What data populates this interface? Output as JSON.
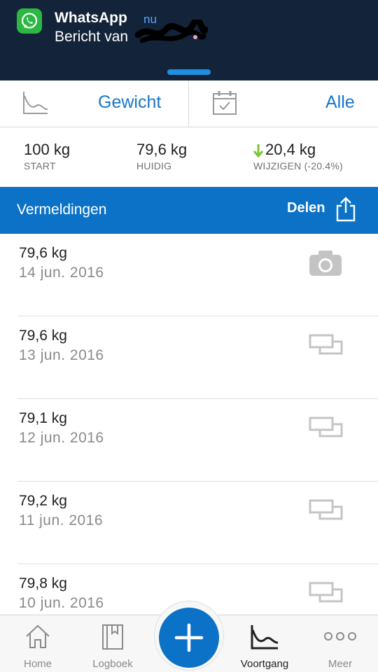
{
  "notification": {
    "app_name": "WhatsApp",
    "time": "nu",
    "message": "Bericht van",
    "icon": "whatsapp-icon"
  },
  "toolbar": {
    "metric_label": "Gewicht",
    "range_label": "Alle",
    "chart_icon": "trend-chart-icon",
    "calendar_icon": "calendar-check-icon"
  },
  "stats": {
    "start": {
      "value": "100 kg",
      "label": "START"
    },
    "current": {
      "value": "79,6 kg",
      "label": "HUIDIG"
    },
    "change": {
      "value": "20,4 kg",
      "label": "WIJZIGEN (-20.4%)"
    }
  },
  "section": {
    "title": "Vermeldingen",
    "share_label": "Delen",
    "share_icon": "share-icon"
  },
  "entries": [
    {
      "weight": "79,6 kg",
      "date": "14 jun. 2016",
      "icon": "camera-icon"
    },
    {
      "weight": "79,6 kg",
      "date": "13 jun. 2016",
      "icon": "scale-sync-icon"
    },
    {
      "weight": "79,1 kg",
      "date": "12 jun. 2016",
      "icon": "scale-sync-icon"
    },
    {
      "weight": "79,2 kg",
      "date": "11 jun. 2016",
      "icon": "scale-sync-icon"
    },
    {
      "weight": "79,8 kg",
      "date": "10 jun. 2016",
      "icon": "scale-sync-icon"
    }
  ],
  "tabs": [
    {
      "label": "Home",
      "icon": "home-icon"
    },
    {
      "label": "Logboek",
      "icon": "book-icon"
    },
    {
      "label": "Voortgang",
      "icon": "progress-chart-icon"
    },
    {
      "label": "Meer",
      "icon": "more-dots-icon"
    }
  ],
  "colors": {
    "accent": "#0b72c7",
    "notification_bg": "#13243a",
    "whatsapp_green": "#2bb741",
    "down_arrow": "#7cc43a"
  }
}
